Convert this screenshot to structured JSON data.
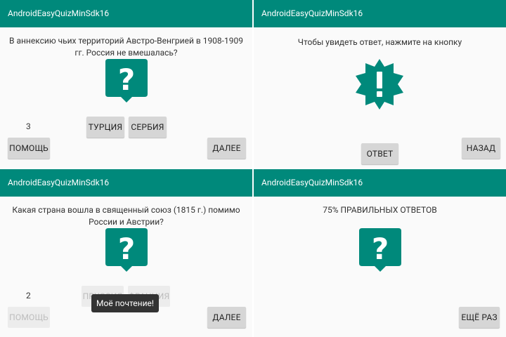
{
  "app_title": "AndroidEasyQuizMinSdk16",
  "colors": {
    "accent": "#00897b",
    "button": "#d6d6d6",
    "background": "#fafafa"
  },
  "pane1": {
    "question": "В аннексию чьих территорий Австро-Венгрией в 1908-1909 гг. Россия не вмешалась?",
    "icon": "question-icon",
    "counter": "3",
    "answer1": "ТУРЦИЯ",
    "answer2": "СЕРБИЯ",
    "help": "ПОМОЩЬ",
    "next": "ДАЛЕЕ"
  },
  "pane2": {
    "prompt": "Чтобы увидеть ответ, нажмите на кнопку",
    "icon": "alert-badge-icon",
    "answer": "ОТВЕТ",
    "back": "НАЗАД"
  },
  "pane3": {
    "question": "Какая страна вошла в священный союз (1815 г.) помимо России и Австрии?",
    "icon": "question-icon",
    "counter": "2",
    "answer1": "ПРУССИЯ",
    "answer2": "ФРАНЦИЯ",
    "help": "ПОМОЩЬ",
    "next": "ДАЛЕЕ",
    "toast": "Моё почтение!"
  },
  "pane4": {
    "result": "75% ПРАВИЛЬНЫХ ОТВЕТОВ",
    "icon": "question-icon",
    "again": "ЕЩЁ РАЗ"
  }
}
